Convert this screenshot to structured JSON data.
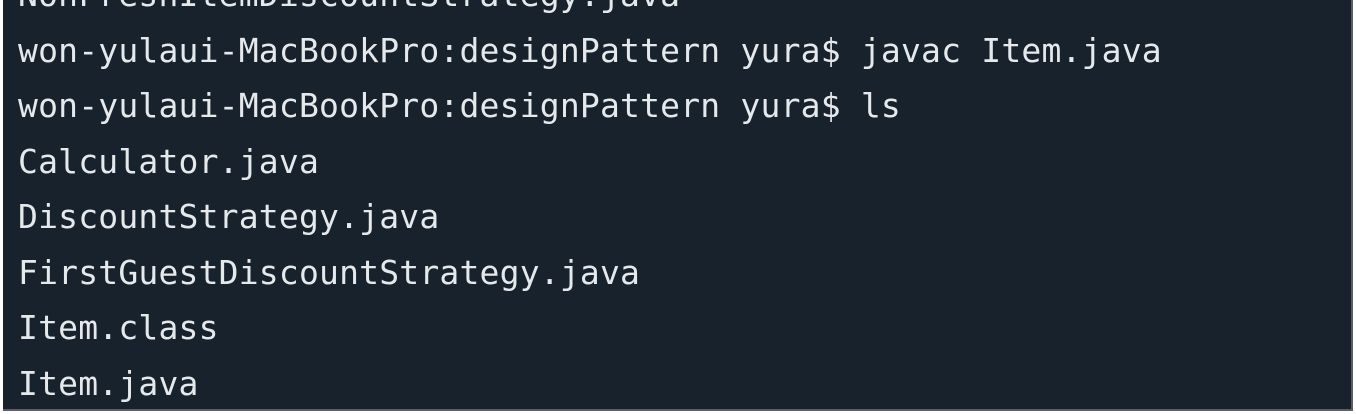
{
  "terminal": {
    "lines": [
      "NonFreshItemDiscountStrategy.java",
      "won-yulaui-MacBookPro:designPattern yura$ javac Item.java",
      "won-yulaui-MacBookPro:designPattern yura$ ls",
      "Calculator.java",
      "DiscountStrategy.java",
      "FirstGuestDiscountStrategy.java",
      "Item.class",
      "Item.java"
    ]
  },
  "colors": {
    "background": "#17222d",
    "text": "#e6e9ec"
  }
}
